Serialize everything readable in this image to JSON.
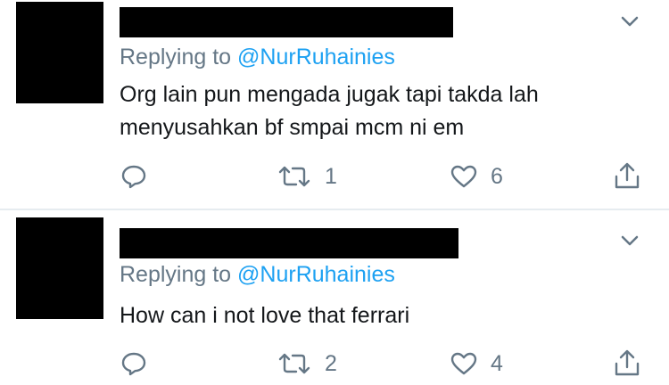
{
  "tweets": [
    {
      "replying_prefix": "Replying to",
      "replying_handle": "@NurRuhainies",
      "text_lines": [
        "Org lain pun mengada jugak tapi takda lah",
        "menyusahkan bf smpai mcm ni em"
      ],
      "retweet_count": "1",
      "like_count": "6"
    },
    {
      "replying_prefix": "Replying to",
      "replying_handle": "@NurRuhainies",
      "text_lines": [
        "How can i not love that ferrari"
      ],
      "retweet_count": "2",
      "like_count": "4"
    }
  ],
  "icons": {
    "reply": "reply-icon",
    "retweet": "retweet-icon",
    "like": "heart-icon",
    "share": "share-icon",
    "more": "chevron-down-icon"
  },
  "colors": {
    "secondary_text": "#657786",
    "link": "#1da1f2",
    "primary_text": "#14171a",
    "divider": "#e6ecf0"
  }
}
